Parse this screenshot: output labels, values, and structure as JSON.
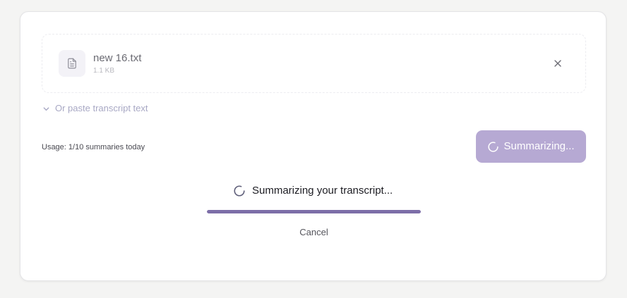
{
  "file": {
    "name": "new 16.txt",
    "size": "1.1 KB",
    "icon": "document-icon"
  },
  "paste_toggle": {
    "label": "Or paste transcript text",
    "icon": "chevron-down-icon"
  },
  "usage": {
    "text": "Usage: 1/10 summaries today"
  },
  "summarize_button": {
    "label": "Summarizing...",
    "state": "loading",
    "color": "#b6a9d3"
  },
  "progress": {
    "status_text": "Summarizing your transcript...",
    "value": 1.0,
    "fill_color": "#7d6ea8"
  },
  "cancel": {
    "label": "Cancel"
  }
}
